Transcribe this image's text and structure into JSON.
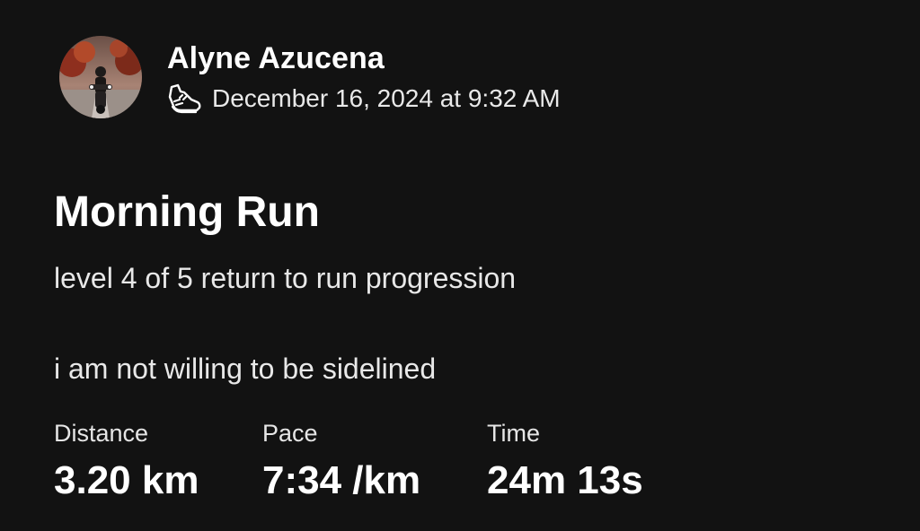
{
  "athlete": {
    "name": "Alyne Azucena",
    "activity_icon": "running-shoe-icon",
    "timestamp": "December 16, 2024 at 9:32 AM"
  },
  "activity": {
    "title": "Morning Run",
    "description_lines": [
      "level 4 of 5 return to run progression",
      "i am not willing to be sidelined"
    ]
  },
  "stats": [
    {
      "label": "Distance",
      "value": "3.20 km"
    },
    {
      "label": "Pace",
      "value": "7:34 /km"
    },
    {
      "label": "Time",
      "value": "24m 13s"
    }
  ],
  "colors": {
    "background": "#121212",
    "text_primary": "#ffffff",
    "text_secondary": "#e8e8e8"
  }
}
